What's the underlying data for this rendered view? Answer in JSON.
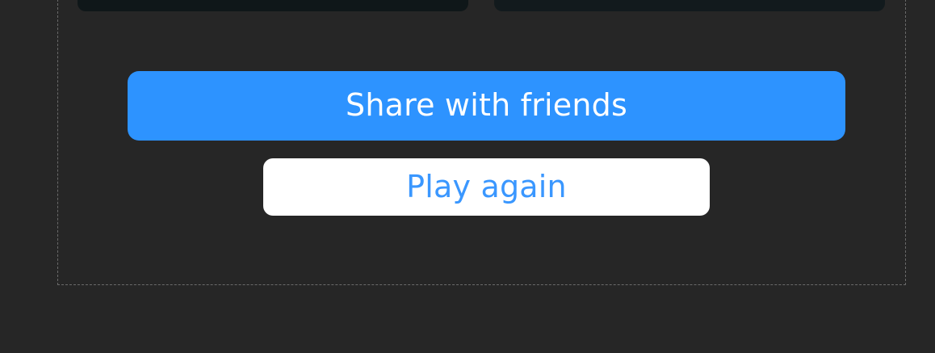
{
  "actions": {
    "share_label": "Share with friends",
    "play_again_label": "Play again"
  },
  "colors": {
    "background": "#262626",
    "primary": "#2d93ff",
    "secondary_bg": "#ffffff",
    "secondary_text": "#3a97ff"
  }
}
